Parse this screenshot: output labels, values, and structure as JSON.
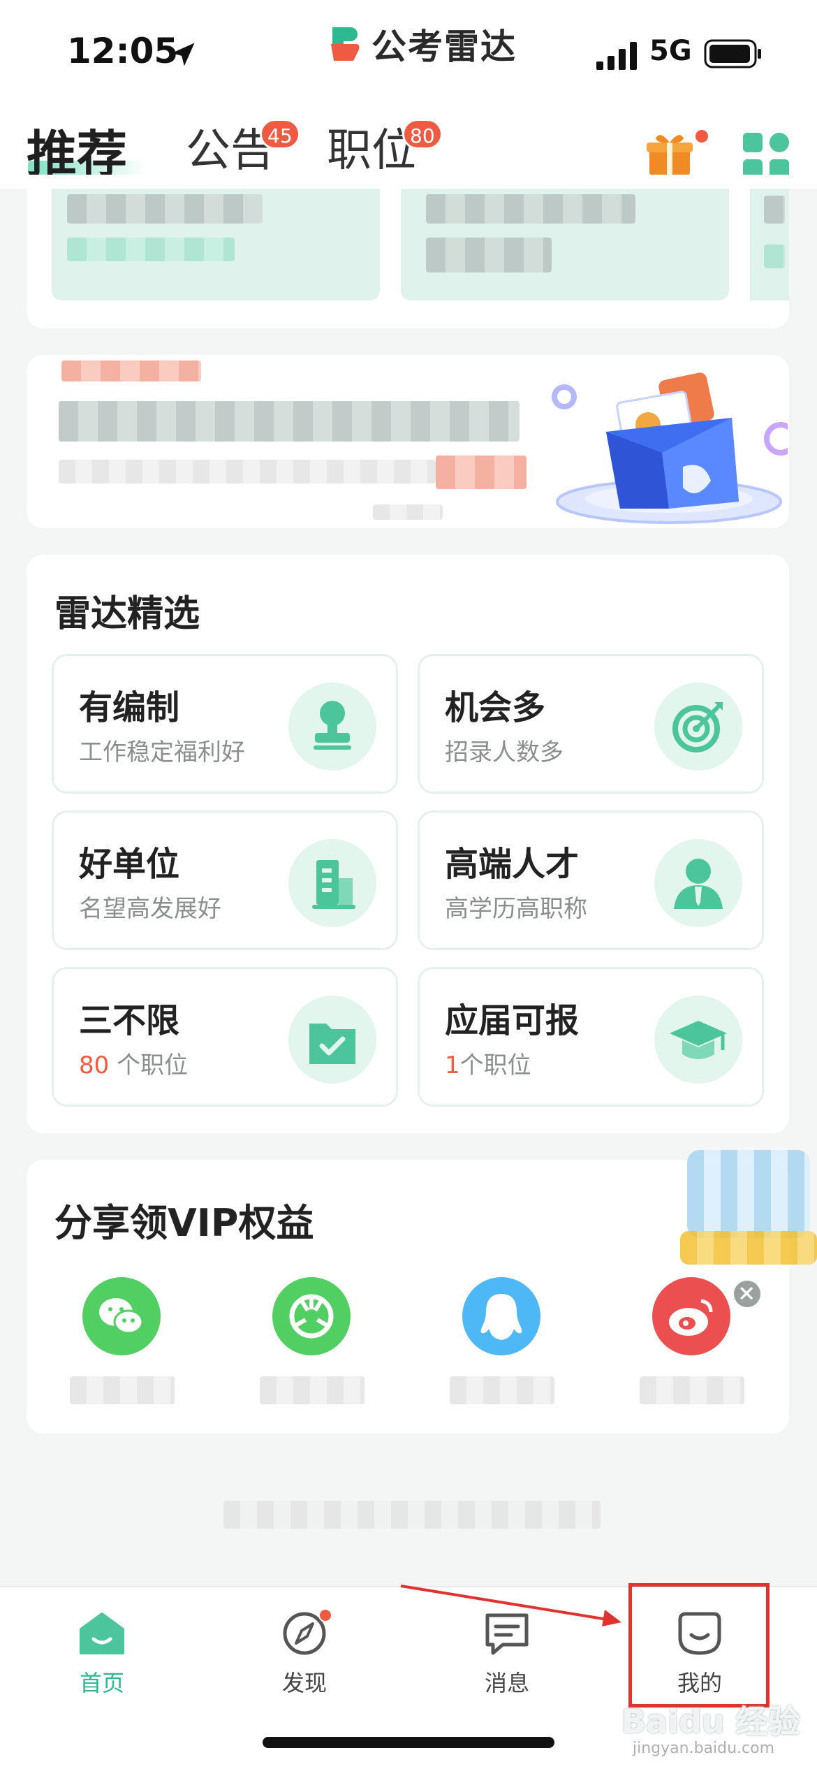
{
  "status_bar": {
    "time": "12:05",
    "network": "5G"
  },
  "brand": {
    "name": "公考雷达"
  },
  "header": {
    "tabs": [
      {
        "label": "推荐",
        "active": true
      },
      {
        "label": "公告",
        "badge": "45"
      },
      {
        "label": "职位",
        "badge": "80"
      }
    ]
  },
  "radar": {
    "title": "雷达精选",
    "items": [
      {
        "title": "有编制",
        "subtitle": "工作稳定福利好",
        "icon": "stamp-icon"
      },
      {
        "title": "机会多",
        "subtitle": "招录人数多",
        "icon": "target-icon"
      },
      {
        "title": "好单位",
        "subtitle": "名望高发展好",
        "icon": "building-icon"
      },
      {
        "title": "高端人才",
        "subtitle": "高学历高职称",
        "icon": "person-icon"
      },
      {
        "title": "三不限",
        "count": "80",
        "unit": " 个职位",
        "icon": "folder-check-icon"
      },
      {
        "title": "应届可报",
        "count": "1",
        "unit": "个职位",
        "icon": "graduation-cap-icon"
      }
    ]
  },
  "share": {
    "title": "分享领VIP权益",
    "icons": [
      "wechat-icon",
      "moments-icon",
      "qq-icon",
      "weibo-icon"
    ]
  },
  "tabbar": {
    "items": [
      {
        "label": "首页",
        "icon": "home-icon",
        "active": true
      },
      {
        "label": "发现",
        "icon": "compass-icon"
      },
      {
        "label": "消息",
        "icon": "message-icon"
      },
      {
        "label": "我的",
        "icon": "smile-icon"
      }
    ]
  },
  "colors": {
    "accent": "#2cb890",
    "badge": "#ef5b42",
    "annotation": "#e0322e"
  },
  "watermark": {
    "logo": "Baidu 经验",
    "url": "jingyan.baidu.com"
  }
}
